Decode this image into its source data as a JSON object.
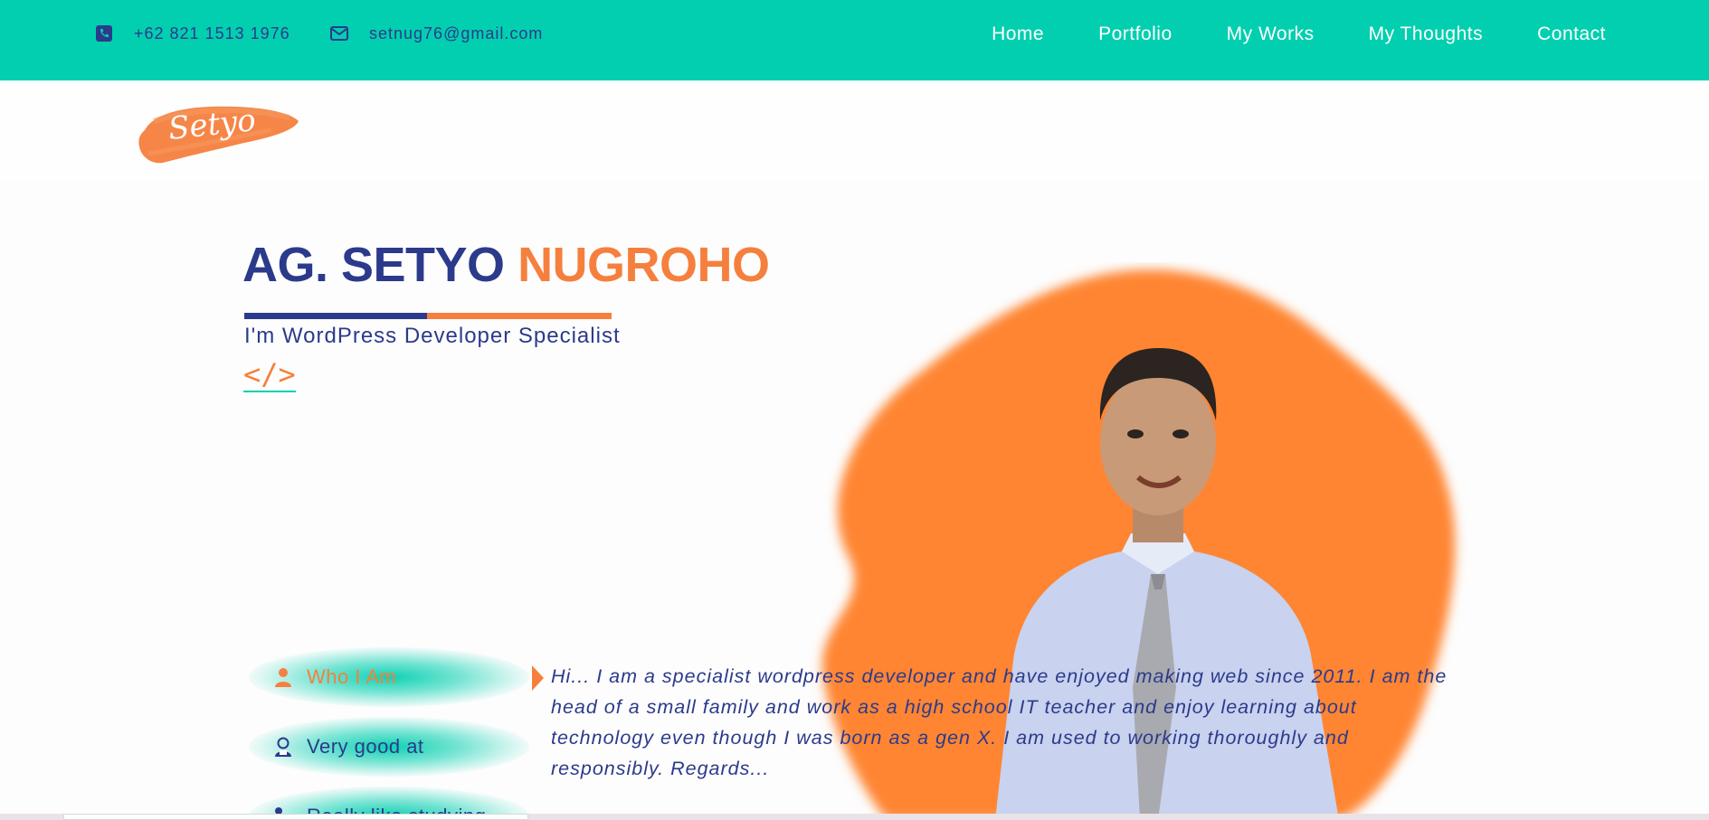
{
  "topbar": {
    "phone": "+62 821 1513 1976",
    "email": "setnug76@gmail.com",
    "phone_icon": "phone-icon",
    "email_icon": "envelope-icon"
  },
  "nav": {
    "items": [
      {
        "label": "Home"
      },
      {
        "label": "Portfolio"
      },
      {
        "label": "My Works"
      },
      {
        "label": "My Thoughts"
      },
      {
        "label": "Contact"
      }
    ]
  },
  "logo": {
    "text": "Setyo"
  },
  "hero": {
    "name_first": "AG. SETYO",
    "name_last": "NUGROHO",
    "subtitle": "I'm WordPress Developer Specialist",
    "code_tag": "</>"
  },
  "tabs": [
    {
      "label": "Who I Am",
      "icon": "user-icon",
      "active": true
    },
    {
      "label": "Very good at",
      "icon": "developer-icon",
      "active": false
    },
    {
      "label": "Really like studying",
      "icon": "study-icon",
      "active": false
    }
  ],
  "about": {
    "text": "Hi... I am a specialist wordpress developer and have enjoyed making web since 2011. I am the head of a small family and work as a high school IT teacher and enjoy learning about technology even though I was born as a gen X. I am used to working thoroughly and responsibly. Regards..."
  },
  "colors": {
    "teal": "#02cfaf",
    "navy": "#2c3a8b",
    "orange": "#f5803e"
  }
}
